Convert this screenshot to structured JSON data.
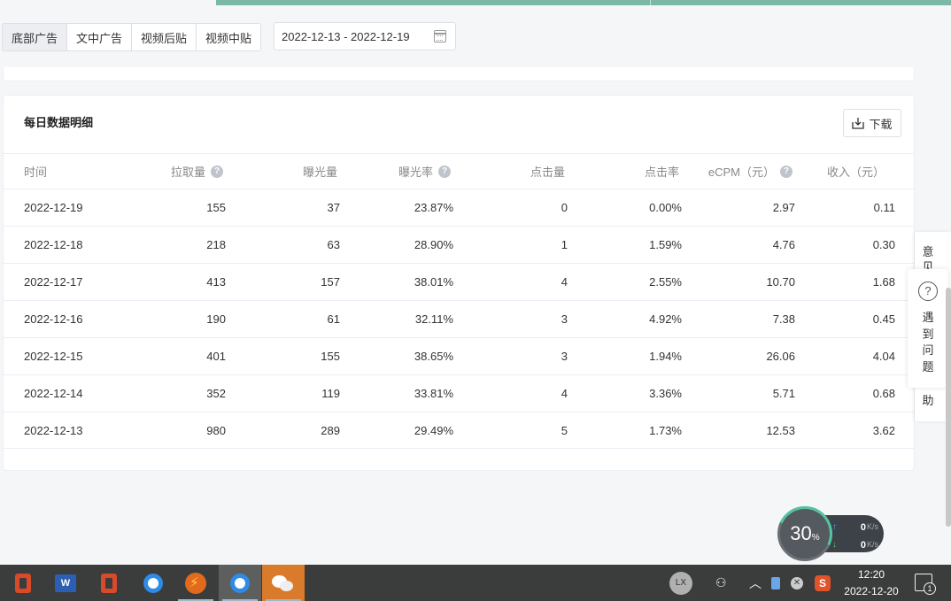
{
  "tabs": [
    {
      "label": "底部广告",
      "active": true
    },
    {
      "label": "文中广告",
      "active": false
    },
    {
      "label": "视频后贴",
      "active": false
    },
    {
      "label": "视频中贴",
      "active": false
    }
  ],
  "date_range": {
    "value": "2022-12-13 - 2022-12-19",
    "icon": "calendar-icon"
  },
  "card": {
    "title": "每日数据明细",
    "download_label": "下载",
    "download_icon": "download-icon"
  },
  "table": {
    "headers": [
      "时间",
      "拉取量",
      "曝光量",
      "曝光率",
      "点击量",
      "点击率",
      "eCPM（元）",
      "收入（元）"
    ],
    "help_icon_columns": [
      1,
      3,
      6
    ],
    "rows": [
      [
        "2022-12-19",
        "155",
        "37",
        "23.87%",
        "0",
        "0.00%",
        "2.97",
        "0.11"
      ],
      [
        "2022-12-18",
        "218",
        "63",
        "28.90%",
        "1",
        "1.59%",
        "4.76",
        "0.30"
      ],
      [
        "2022-12-17",
        "413",
        "157",
        "38.01%",
        "4",
        "2.55%",
        "10.70",
        "1.68"
      ],
      [
        "2022-12-16",
        "190",
        "61",
        "32.11%",
        "3",
        "4.92%",
        "7.38",
        "0.45"
      ],
      [
        "2022-12-15",
        "401",
        "155",
        "38.65%",
        "3",
        "1.94%",
        "26.06",
        "4.04"
      ],
      [
        "2022-12-14",
        "352",
        "119",
        "33.81%",
        "4",
        "3.36%",
        "5.71",
        "0.68"
      ],
      [
        "2022-12-13",
        "980",
        "289",
        "29.49%",
        "5",
        "1.73%",
        "12.53",
        "3.62"
      ]
    ]
  },
  "side_panel": {
    "top_text": "意见",
    "help_text": "遇到问题",
    "bottom_text": "助",
    "help_icon": "question-circle-icon"
  },
  "speed_widget": {
    "percent": "30",
    "percent_sign": "%",
    "upload": "0",
    "download": "0",
    "unit": "K/s"
  },
  "taskbar": {
    "apps": [
      "office-icon",
      "word-icon",
      "office-icon",
      "browser-q-icon",
      "zigzag-app-icon",
      "browser-q-icon",
      "wechat-icon"
    ],
    "word_glyph": "W",
    "avatar": "LX",
    "time": "12:20",
    "date": "2022-12-20",
    "notification_count": "1"
  }
}
